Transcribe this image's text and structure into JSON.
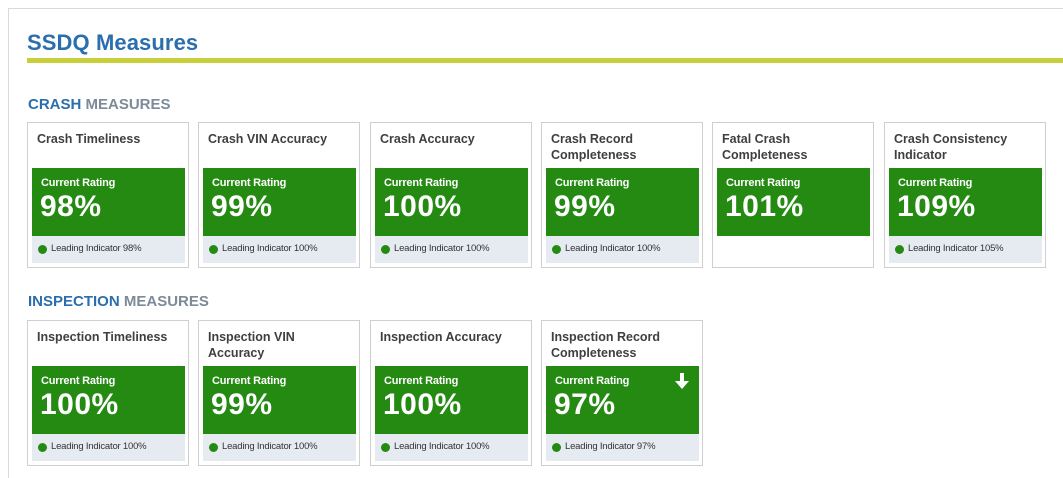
{
  "page": {
    "title": "SSDQ Measures"
  },
  "colors": {
    "rating_green": "#248a12",
    "title_blue": "#2a6ead",
    "rule_yellow_green": "#c7cf3a"
  },
  "crash": {
    "heading_accent": "CRASH",
    "heading_rest": " MEASURES",
    "cards": [
      {
        "title": "Crash Timeliness",
        "rating_label": "Current Rating",
        "rating": "98%",
        "indicator": "Leading Indicator 98%"
      },
      {
        "title": "Crash VIN Accuracy",
        "rating_label": "Current Rating",
        "rating": "99%",
        "indicator": "Leading Indicator 100%"
      },
      {
        "title": "Crash Accuracy",
        "rating_label": "Current Rating",
        "rating": "100%",
        "indicator": "Leading Indicator 100%"
      },
      {
        "title": "Crash Record Completeness",
        "rating_label": "Current Rating",
        "rating": "99%",
        "indicator": "Leading Indicator 100%"
      },
      {
        "title": "Fatal Crash Completeness",
        "rating_label": "Current Rating",
        "rating": "101%"
      },
      {
        "title": "Crash Consistency Indicator",
        "rating_label": "Current Rating",
        "rating": "109%",
        "indicator": "Leading Indicator 105%"
      }
    ]
  },
  "inspection": {
    "heading_accent": "INSPECTION",
    "heading_rest": " MEASURES",
    "cards": [
      {
        "title": "Inspection Timeliness",
        "rating_label": "Current Rating",
        "rating": "100%",
        "indicator": "Leading Indicator 100%"
      },
      {
        "title": "Inspection VIN Accuracy",
        "rating_label": "Current Rating",
        "rating": "99%",
        "indicator": "Leading Indicator 100%"
      },
      {
        "title": "Inspection Accuracy",
        "rating_label": "Current Rating",
        "rating": "100%",
        "indicator": "Leading Indicator 100%"
      },
      {
        "title": "Inspection Record Completeness",
        "rating_label": "Current Rating",
        "rating": "97%",
        "indicator": "Leading Indicator 97%",
        "trend_icon": "arrow-down-icon"
      }
    ]
  }
}
